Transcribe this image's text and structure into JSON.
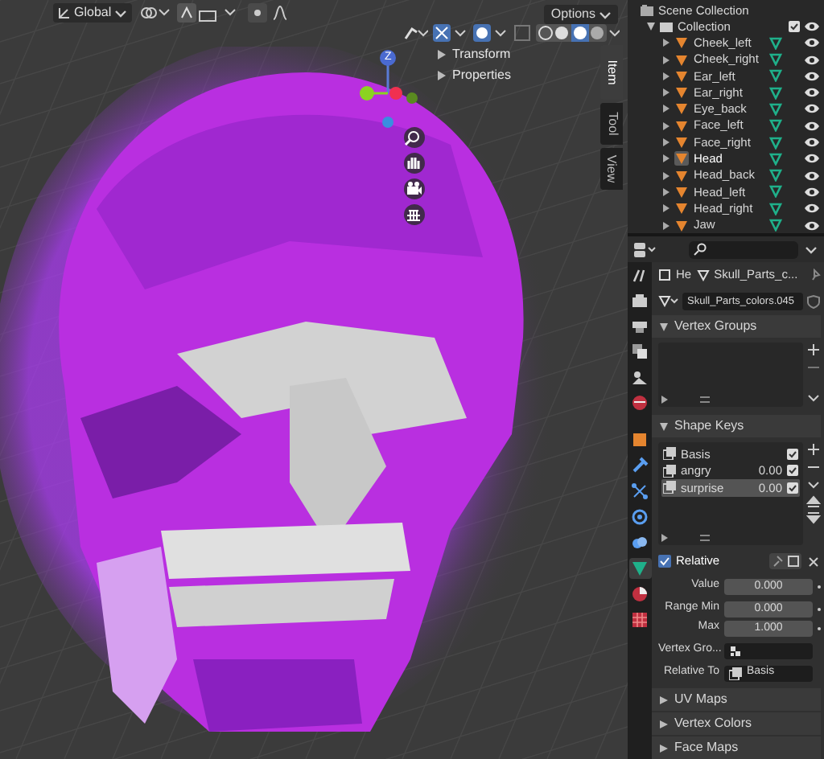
{
  "viewport": {
    "orientation": "Global",
    "options": "Options",
    "sidebar_panels": [
      "Transform",
      "Properties"
    ],
    "sidebar_tabs": [
      {
        "label": "Item",
        "selected": true
      },
      {
        "label": "Tool",
        "selected": false
      },
      {
        "label": "View",
        "selected": false
      }
    ],
    "gizmo_label": "Z"
  },
  "outliner": {
    "scene": "Scene Collection",
    "collection": {
      "name": "Collection",
      "expanded": true,
      "children": [
        {
          "name": "Cheek_left",
          "selected": false
        },
        {
          "name": "Cheek_right",
          "selected": false
        },
        {
          "name": "Ear_left",
          "selected": false
        },
        {
          "name": "Ear_right",
          "selected": false
        },
        {
          "name": "Eye_back",
          "selected": false
        },
        {
          "name": "Face_left",
          "selected": false
        },
        {
          "name": "Face_right",
          "selected": false
        },
        {
          "name": "Head",
          "selected": true
        },
        {
          "name": "Head_back",
          "selected": false
        },
        {
          "name": "Head_left",
          "selected": false
        },
        {
          "name": "Head_right",
          "selected": false
        },
        {
          "name": "Jaw",
          "selected": false
        }
      ]
    }
  },
  "properties": {
    "breadcrumb": [
      "He",
      "Skull_Parts_c..."
    ],
    "mesh_name": "Skull_Parts_colors.045",
    "tabs": [
      {
        "kind": "tool",
        "selected": false
      },
      {
        "kind": "render",
        "selected": false
      },
      {
        "kind": "output",
        "selected": false
      },
      {
        "kind": "view-layer",
        "selected": false
      },
      {
        "kind": "scene",
        "selected": false
      },
      {
        "kind": "world",
        "selected": false
      },
      {
        "kind": "object",
        "selected": false
      },
      {
        "kind": "modifier",
        "selected": false
      },
      {
        "kind": "particles",
        "selected": false
      },
      {
        "kind": "physics",
        "selected": false
      },
      {
        "kind": "constraints",
        "selected": false
      },
      {
        "kind": "data",
        "selected": true
      },
      {
        "kind": "material",
        "selected": false
      },
      {
        "kind": "texture",
        "selected": false
      }
    ],
    "vertex_groups": {
      "title": "Vertex Groups",
      "expanded": true
    },
    "shape_keys": {
      "title": "Shape Keys",
      "expanded": true,
      "keys": [
        {
          "name": "Basis",
          "checked": true,
          "selected": false
        },
        {
          "name": "angry",
          "value": "0.00",
          "checked": true,
          "selected": false
        },
        {
          "name": "surprise",
          "value": "0.00",
          "checked": true,
          "selected": true
        }
      ]
    },
    "relative": {
      "label": "Relative",
      "checked": true
    },
    "fields": [
      {
        "label": "Value",
        "value": "0.000"
      },
      {
        "label": "Range Min",
        "value": "0.000"
      },
      {
        "label": "Max",
        "value": "1.000"
      }
    ],
    "vertex_group_label": "Vertex Gro...",
    "relative_to": {
      "label": "Relative To",
      "value": "Basis"
    },
    "collapsed_panels": [
      "UV Maps",
      "Vertex Colors",
      "Face Maps"
    ]
  }
}
